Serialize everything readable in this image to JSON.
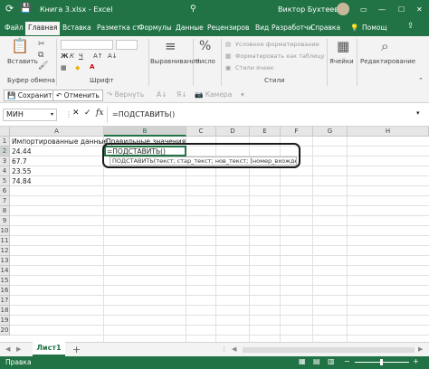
{
  "window": {
    "title": "Книга 3.xlsx - Excel",
    "user": "Виктор Бухтеев",
    "controls": [
      "—",
      "☐",
      "✕"
    ]
  },
  "tabs": [
    "Файл",
    "Главная",
    "Вставка",
    "Разметка ст",
    "Формулы",
    "Данные",
    "Рецензиров",
    "Вид",
    "Разработчи",
    "Справка",
    "Помощ"
  ],
  "ribbon": {
    "groups": {
      "clipboard_btn": "Вставить",
      "clipboard_label": "Буфер обмена",
      "font_label": "Шрифт",
      "align_btn": "Выравнивание",
      "number_btn": "Число",
      "styles_label": "Стили",
      "cond_format": "Условное форматирование",
      "format_table": "Форматировать как таблицу",
      "cell_styles": "Стили ячеек",
      "cells_btn": "Ячейки",
      "editing_btn": "Редактирование"
    },
    "font_sample": "A"
  },
  "qat": {
    "save": "Сохранить",
    "undo": "Отменить",
    "redo": "Вернуть",
    "camera": "Камера"
  },
  "formula_bar": {
    "name_box": "МИН",
    "cancel": "✕",
    "enter": "✓",
    "fx": "fx",
    "content": "=ПОДСТАВИТЬ()"
  },
  "grid": {
    "columns": [
      "A",
      "B",
      "C",
      "D",
      "E",
      "F",
      "G",
      "H"
    ],
    "rows": [
      "1",
      "2",
      "3",
      "4",
      "5",
      "6",
      "7",
      "8",
      "9",
      "10",
      "11",
      "12",
      "13",
      "14",
      "15",
      "16",
      "17",
      "18",
      "19",
      "20"
    ],
    "A1": "Импортированные данные",
    "B1": "Правильные значения",
    "A2": "24.44",
    "A3": "67.7",
    "A4": "23.55",
    "A5": "74.84",
    "B2": "=ПОДСТАВИТЬ()",
    "tooltip": "ПОДСТАВИТЬ(текст; стар_текст; нов_текст; [номер_вхождения])"
  },
  "sheets": {
    "active": "Лист1",
    "add": "+"
  },
  "status": {
    "mode": "Правка"
  },
  "colors": {
    "accent": "#217346",
    "highlight_circle": "#1a1a1a"
  }
}
